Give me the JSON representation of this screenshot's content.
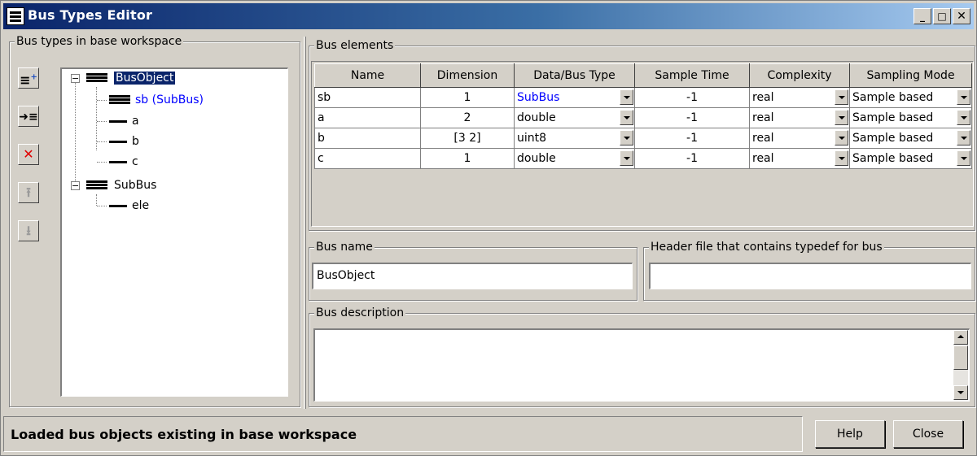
{
  "window": {
    "title": "Bus Types Editor",
    "controls": {
      "minimize": "_",
      "maximize": "□",
      "close": "✕"
    }
  },
  "left_panel": {
    "label": "Bus types in base workspace",
    "toolbar": [
      {
        "name": "add-bus-button",
        "icon": "add-bus-icon",
        "glyph": "≡⁺",
        "enabled": true
      },
      {
        "name": "add-element-button",
        "icon": "insert-element-icon",
        "glyph": "➜≡",
        "enabled": true
      },
      {
        "name": "delete-button",
        "icon": "delete-x-icon",
        "glyph": "✕",
        "enabled": true
      },
      {
        "name": "move-up-button",
        "icon": "move-up-icon",
        "glyph": "⭱",
        "enabled": false
      },
      {
        "name": "move-down-button",
        "icon": "move-down-icon",
        "glyph": "⭳",
        "enabled": false
      }
    ],
    "tree": {
      "buses": [
        {
          "name": "BusObject",
          "expanded": true,
          "selected": true,
          "elements": [
            {
              "label": "sb  (SubBus)",
              "is_bus": true
            },
            {
              "label": "a",
              "is_bus": false
            },
            {
              "label": "b",
              "is_bus": false
            },
            {
              "label": "c",
              "is_bus": false
            }
          ]
        },
        {
          "name": "SubBus",
          "expanded": true,
          "selected": false,
          "elements": [
            {
              "label": "ele",
              "is_bus": false
            }
          ]
        }
      ]
    }
  },
  "bus_elements": {
    "label": "Bus elements",
    "columns": [
      "Name",
      "Dimension",
      "Data/Bus Type",
      "Sample Time",
      "Complexity",
      "Sampling Mode"
    ],
    "rows": [
      {
        "name": "sb",
        "dimension": "1",
        "type": "SubBus",
        "sample_time": "-1",
        "complexity": "real",
        "sampling_mode": "Sample based"
      },
      {
        "name": "a",
        "dimension": "2",
        "type": "double",
        "sample_time": "-1",
        "complexity": "real",
        "sampling_mode": "Sample based"
      },
      {
        "name": "b",
        "dimension": "[3 2]",
        "type": "uint8",
        "sample_time": "-1",
        "complexity": "real",
        "sampling_mode": "Sample based"
      },
      {
        "name": "c",
        "dimension": "1",
        "type": "double",
        "sample_time": "-1",
        "complexity": "real",
        "sampling_mode": "Sample based"
      }
    ]
  },
  "bus_name": {
    "label": "Bus name",
    "value": "BusObject"
  },
  "header_file": {
    "label": "Header file that contains typedef for bus",
    "value": ""
  },
  "bus_description": {
    "label": "Bus description",
    "value": ""
  },
  "status": {
    "message": "Loaded bus objects existing in base workspace"
  },
  "buttons": {
    "help": "Help",
    "close": "Close"
  },
  "colors": {
    "title_start": "#0a246a",
    "title_end": "#a6caf0",
    "face": "#d4d0c8",
    "link_blue": "#0000ff",
    "selection": "#0a246a"
  }
}
